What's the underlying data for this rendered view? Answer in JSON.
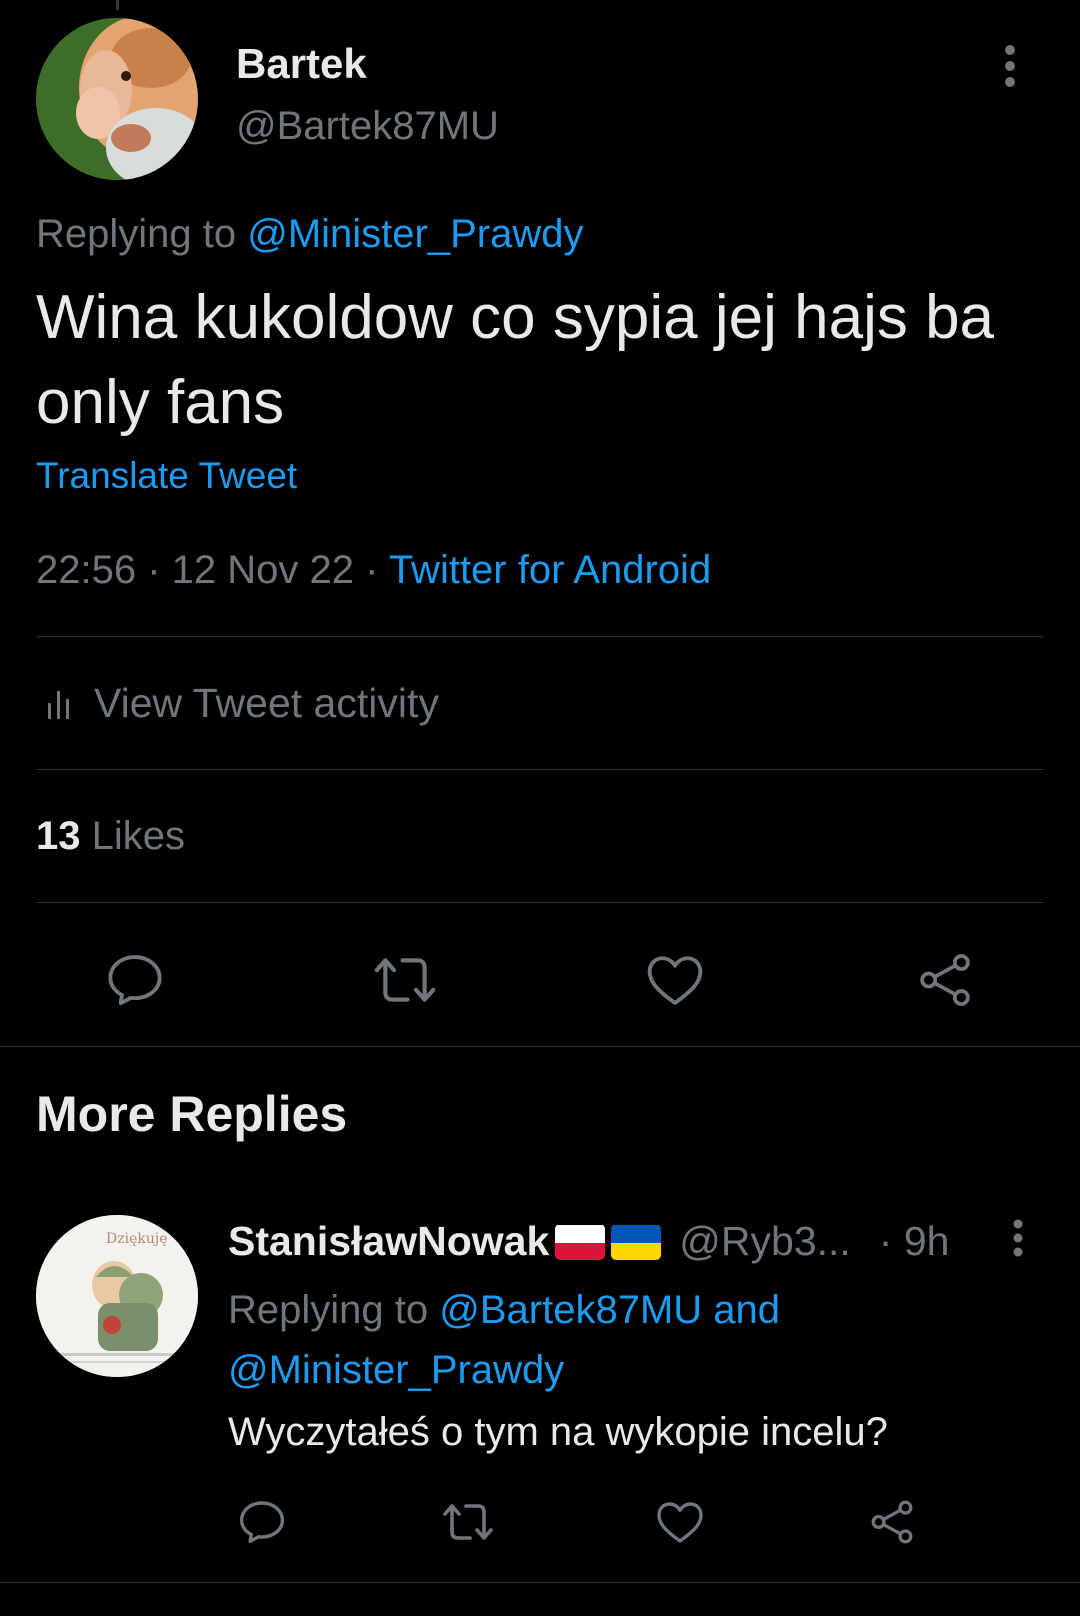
{
  "tweet": {
    "author_name": "Bartek",
    "author_handle": "@Bartek87MU",
    "replying_prefix": "Replying to ",
    "replying_to": "@Minister_Prawdy",
    "text": "Wina kukoldow co sypia jej hajs ba only fans",
    "translate_label": "Translate Tweet",
    "time": "22:56",
    "date": "12 Nov 22",
    "separator": " · ",
    "source": "Twitter for Android",
    "activity_label": "View Tweet activity",
    "likes_count": "13",
    "likes_label": "Likes"
  },
  "section": {
    "title": "More Replies"
  },
  "reply": {
    "author_name": "StanisławNowak",
    "author_handle": "@Ryb3...",
    "age": "· 9h",
    "replying_prefix": "Replying to ",
    "replying_to_1": "@Bartek87MU and",
    "replying_to_2": "@Minister_Prawdy",
    "text": "Wyczytałeś o tym na wykopie incelu?"
  },
  "icons": {
    "reply": "reply-icon",
    "retweet": "retweet-icon",
    "like": "heart-icon",
    "share": "share-icon",
    "more": "more-vertical-icon",
    "activity": "bar-chart-icon"
  },
  "colors": {
    "background": "#000000",
    "text_primary": "#e7e9ea",
    "text_secondary": "#71767b",
    "accent": "#1d9bf0",
    "divider": "#2f3336"
  }
}
